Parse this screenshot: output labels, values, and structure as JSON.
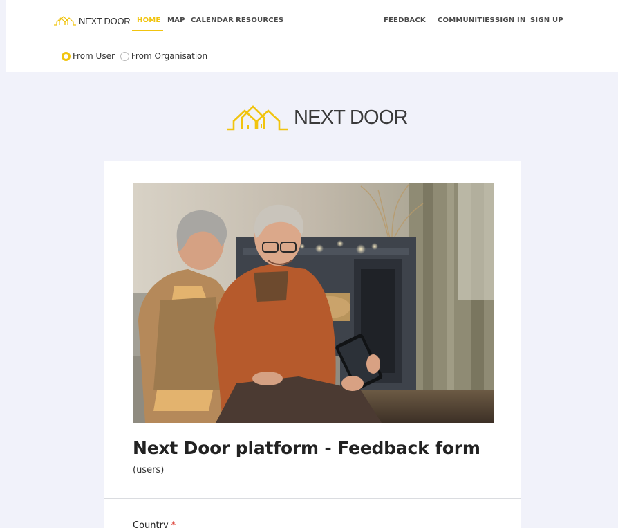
{
  "brand": {
    "name": "NEXT DOOR"
  },
  "nav": {
    "home": "HOME",
    "map": "MAP",
    "calendar": "CALENDAR",
    "resources": "RESOURCES",
    "feedback": "FEEDBACK",
    "communities": "COMMUNITIES",
    "sign_in": "SIGN IN",
    "sign_up": "SIGN UP"
  },
  "radio": {
    "from_user": "From User",
    "from_organisation": "From Organisation",
    "selected": "From User"
  },
  "form": {
    "title": "Next Door platform - Feedback form",
    "subtitle": "(users)",
    "first_field_label": "Country",
    "required_mark": "*"
  },
  "colors": {
    "accent": "#f1c40f",
    "page_bg": "#f1f2fa",
    "card_bg": "#ffffff",
    "required": "#d93025"
  },
  "icons": {
    "logo": "house-roofs-logo"
  }
}
